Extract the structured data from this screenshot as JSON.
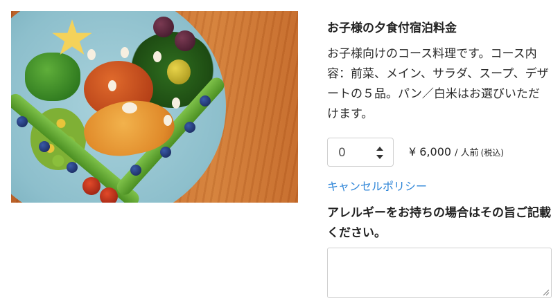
{
  "product": {
    "title": "お子様の夕食付宿泊料金",
    "description": "お子様向けのコース料理です。コース内容：前菜、メイン、サラダ、スープ、デザートの５品。パン／白米はお選びいただけます。",
    "image_icon": "food-photo"
  },
  "quantity": {
    "value": "0"
  },
  "price": {
    "amount": "¥ 6,000",
    "unit": "/ 人前",
    "tax": "(税込)"
  },
  "links": {
    "cancel_policy": "キャンセルポリシー"
  },
  "allergy": {
    "label": "アレルギーをお持ちの場合はその旨ご記載ください。",
    "value": ""
  },
  "colors": {
    "link": "#2f86d8",
    "text": "#222222",
    "border": "#cfcfcf"
  }
}
